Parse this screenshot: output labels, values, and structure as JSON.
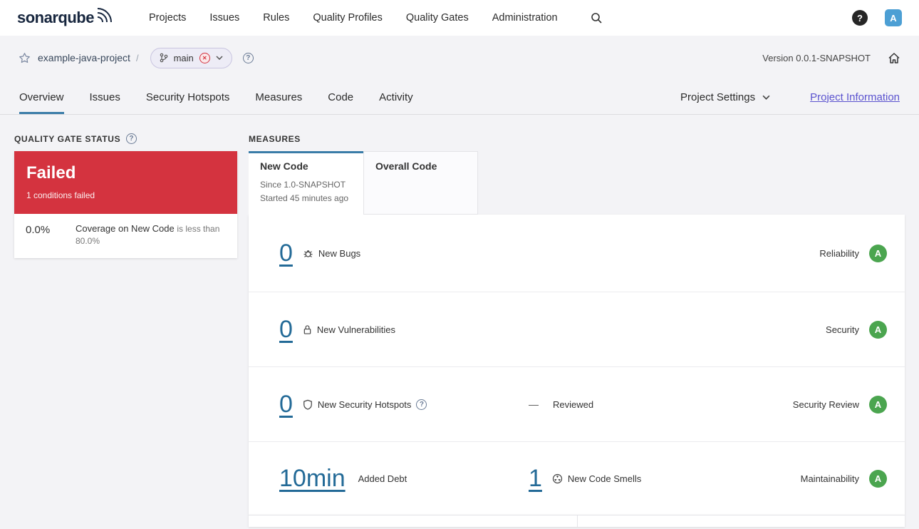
{
  "topnav": {
    "logo": "sonarqube",
    "items": [
      "Projects",
      "Issues",
      "Rules",
      "Quality Profiles",
      "Quality Gates",
      "Administration"
    ],
    "help_glyph": "?",
    "avatar_initial": "A"
  },
  "breadcrumb": {
    "project_name": "example-java-project",
    "separator": "/",
    "branch_name": "main",
    "branch_status_glyph": "✕",
    "help_glyph": "?",
    "version_label": "Version 0.0.1-SNAPSHOT"
  },
  "tabs": {
    "items": [
      "Overview",
      "Issues",
      "Security Hotspots",
      "Measures",
      "Code",
      "Activity"
    ],
    "active_tab": "Overview",
    "project_settings_label": "Project Settings",
    "project_information_label": "Project Information"
  },
  "quality_gate": {
    "heading": "QUALITY GATE STATUS",
    "help_glyph": "?",
    "status": "Failed",
    "conditions_summary": "1 conditions failed",
    "condition_value": "0.0%",
    "condition_metric": "Coverage on New Code",
    "condition_comparison": "is less than 80.0%"
  },
  "measures": {
    "heading": "MEASURES",
    "new_code_tab": {
      "label": "New Code",
      "since": "Since 1.0-SNAPSHOT",
      "started": "Started 45 minutes ago"
    },
    "overall_code_tab": {
      "label": "Overall Code"
    },
    "rows": [
      {
        "value": "0",
        "label": "New Bugs",
        "category": "Reliability",
        "rating": "A"
      },
      {
        "value": "0",
        "label": "New Vulnerabilities",
        "category": "Security",
        "rating": "A"
      },
      {
        "value": "0",
        "label": "New Security Hotspots",
        "help_glyph": "?",
        "reviewed_value": "—",
        "reviewed_label": "Reviewed",
        "category": "Security Review",
        "rating": "A"
      },
      {
        "debt_value": "10min",
        "debt_label": "Added Debt",
        "value": "1",
        "label": "New Code Smells",
        "category": "Maintainability",
        "rating": "A"
      }
    ]
  },
  "colors": {
    "failed_red": "#d4333f",
    "rating_a_green": "#4ba54f",
    "link_blue": "#236a97",
    "accent_blue": "#3a7ca8",
    "avatar_blue": "#4c9fd4",
    "info_link_purple": "#5b53cf"
  }
}
